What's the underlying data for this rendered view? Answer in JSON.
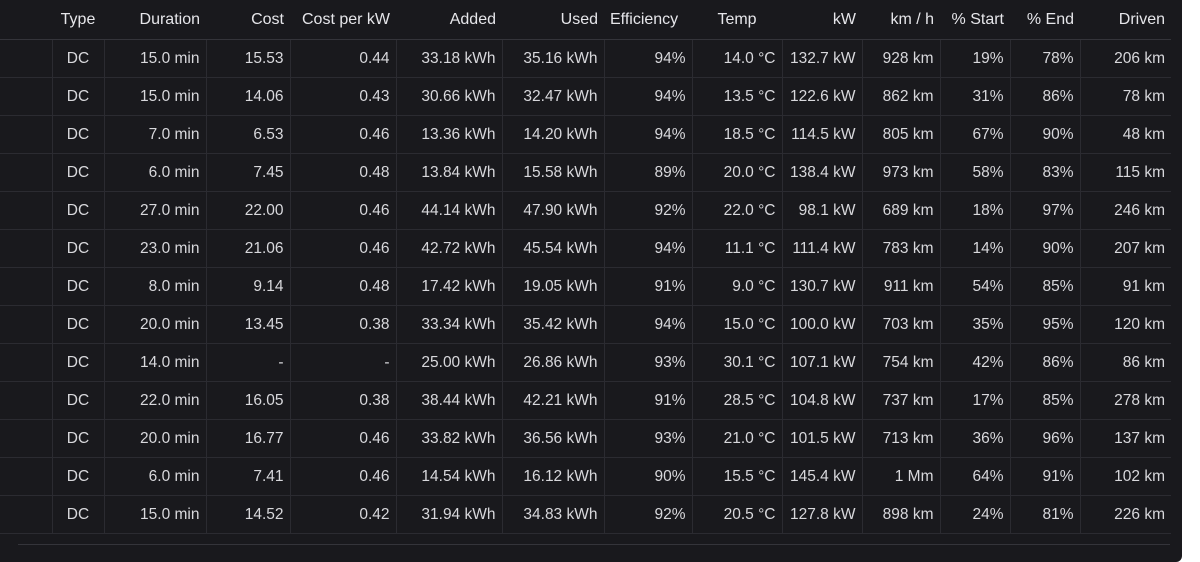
{
  "columns": {
    "type": "Type",
    "duration": "Duration",
    "cost": "Cost",
    "cost_per_kw": "Cost per kW",
    "added": "Added",
    "used": "Used",
    "efficiency": "Efficiency",
    "temp": "Temp",
    "kw": "kW",
    "km_h": "km / h",
    "start": "% Start",
    "end": "% End",
    "driven": "Driven"
  },
  "colors": {
    "cost_link": "#6e9fff",
    "efficiency_good": "#73bf69",
    "efficiency_warn": "#ff9830",
    "kw": "#56a64b",
    "temp_warm": "#ffa6b0",
    "temp_cool": "#c8f2c2",
    "temp_blue": "#c0d8ff"
  },
  "rows": [
    {
      "type": "DC",
      "duration": "15.0 min",
      "cost": "15.53",
      "cost_per_kw": "0.44",
      "added": "33.18 kWh",
      "used": "35.16 kWh",
      "efficiency": "94%",
      "temp": "14.0 °C",
      "kw": "132.7 kW",
      "km_h": "928 km",
      "start": "19%",
      "end": "78%",
      "driven": "206 km"
    },
    {
      "type": "DC",
      "duration": "15.0 min",
      "cost": "14.06",
      "cost_per_kw": "0.43",
      "added": "30.66 kWh",
      "used": "32.47 kWh",
      "efficiency": "94%",
      "temp": "13.5 °C",
      "kw": "122.6 kW",
      "km_h": "862 km",
      "start": "31%",
      "end": "86%",
      "driven": "78 km"
    },
    {
      "type": "DC",
      "duration": "7.0 min",
      "cost": "6.53",
      "cost_per_kw": "0.46",
      "added": "13.36 kWh",
      "used": "14.20 kWh",
      "efficiency": "94%",
      "temp": "18.5 °C",
      "kw": "114.5 kW",
      "km_h": "805 km",
      "start": "67%",
      "end": "90%",
      "driven": "48 km"
    },
    {
      "type": "DC",
      "duration": "6.0 min",
      "cost": "7.45",
      "cost_per_kw": "0.48",
      "added": "13.84 kWh",
      "used": "15.58 kWh",
      "efficiency": "89%",
      "temp": "20.0 °C",
      "kw": "138.4 kW",
      "km_h": "973 km",
      "start": "58%",
      "end": "83%",
      "driven": "115 km"
    },
    {
      "type": "DC",
      "duration": "27.0 min",
      "cost": "22.00",
      "cost_per_kw": "0.46",
      "added": "44.14 kWh",
      "used": "47.90 kWh",
      "efficiency": "92%",
      "temp": "22.0 °C",
      "kw": "98.1 kW",
      "km_h": "689 km",
      "start": "18%",
      "end": "97%",
      "driven": "246 km"
    },
    {
      "type": "DC",
      "duration": "23.0 min",
      "cost": "21.06",
      "cost_per_kw": "0.46",
      "added": "42.72 kWh",
      "used": "45.54 kWh",
      "efficiency": "94%",
      "temp": "11.1 °C",
      "kw": "111.4 kW",
      "km_h": "783 km",
      "start": "14%",
      "end": "90%",
      "driven": "207 km"
    },
    {
      "type": "DC",
      "duration": "8.0 min",
      "cost": "9.14",
      "cost_per_kw": "0.48",
      "added": "17.42 kWh",
      "used": "19.05 kWh",
      "efficiency": "91%",
      "temp": "9.0 °C",
      "kw": "130.7 kW",
      "km_h": "911 km",
      "start": "54%",
      "end": "85%",
      "driven": "91 km"
    },
    {
      "type": "DC",
      "duration": "20.0 min",
      "cost": "13.45",
      "cost_per_kw": "0.38",
      "added": "33.34 kWh",
      "used": "35.42 kWh",
      "efficiency": "94%",
      "temp": "15.0 °C",
      "kw": "100.0 kW",
      "km_h": "703 km",
      "start": "35%",
      "end": "95%",
      "driven": "120 km"
    },
    {
      "type": "DC",
      "duration": "14.0 min",
      "cost": "-",
      "cost_per_kw": "-",
      "added": "25.00 kWh",
      "used": "26.86 kWh",
      "efficiency": "93%",
      "temp": "30.1 °C",
      "kw": "107.1 kW",
      "km_h": "754 km",
      "start": "42%",
      "end": "86%",
      "driven": "86 km"
    },
    {
      "type": "DC",
      "duration": "22.0 min",
      "cost": "16.05",
      "cost_per_kw": "0.38",
      "added": "38.44 kWh",
      "used": "42.21 kWh",
      "efficiency": "91%",
      "temp": "28.5 °C",
      "kw": "104.8 kW",
      "km_h": "737 km",
      "start": "17%",
      "end": "85%",
      "driven": "278 km"
    },
    {
      "type": "DC",
      "duration": "20.0 min",
      "cost": "16.77",
      "cost_per_kw": "0.46",
      "added": "33.82 kWh",
      "used": "36.56 kWh",
      "efficiency": "93%",
      "temp": "21.0 °C",
      "kw": "101.5 kW",
      "km_h": "713 km",
      "start": "36%",
      "end": "96%",
      "driven": "137 km"
    },
    {
      "type": "DC",
      "duration": "6.0 min",
      "cost": "7.41",
      "cost_per_kw": "0.46",
      "added": "14.54 kWh",
      "used": "16.12 kWh",
      "efficiency": "90%",
      "temp": "15.5 °C",
      "kw": "145.4 kW",
      "km_h": "1 Mm",
      "start": "64%",
      "end": "91%",
      "driven": "102 km"
    },
    {
      "type": "DC",
      "duration": "15.0 min",
      "cost": "14.52",
      "cost_per_kw": "0.42",
      "added": "31.94 kWh",
      "used": "34.83 kWh",
      "efficiency": "92%",
      "temp": "20.5 °C",
      "kw": "127.8 kW",
      "km_h": "898 km",
      "start": "24%",
      "end": "81%",
      "driven": "226 km"
    }
  ]
}
